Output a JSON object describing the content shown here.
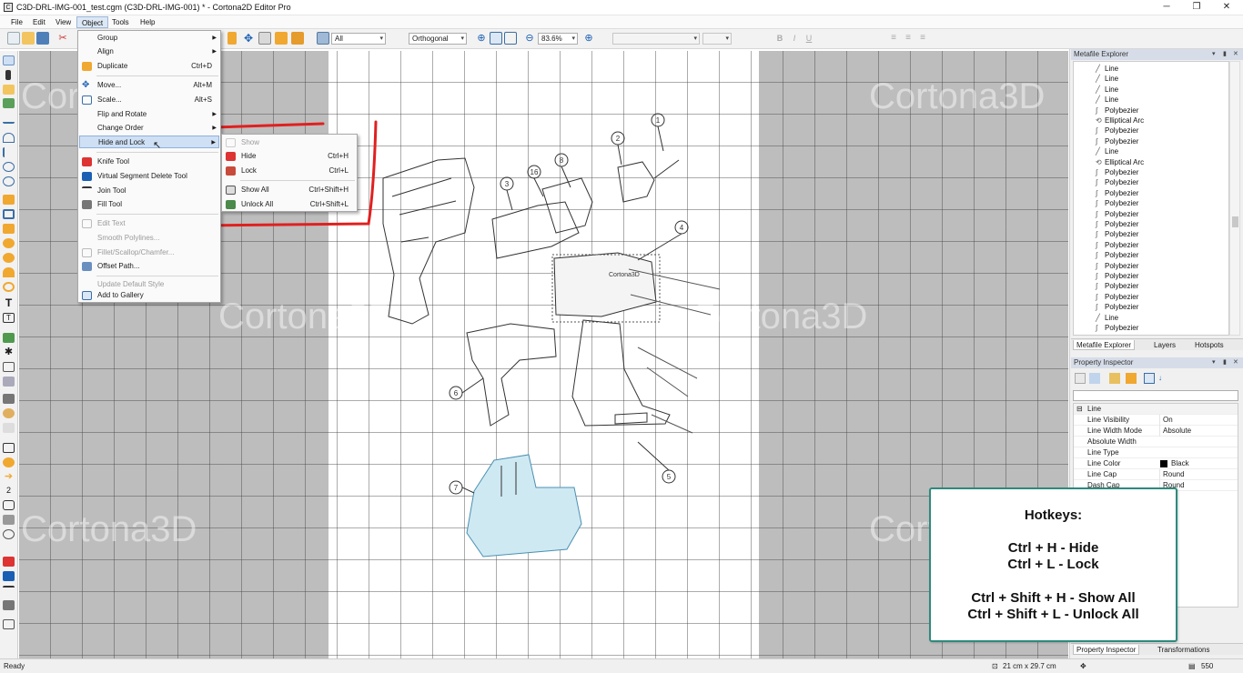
{
  "window": {
    "title": "C3D-DRL-IMG-001_test.cgm (C3D-DRL-IMG-001) * - Cortona2D Editor Pro",
    "app_icon": "C",
    "minimize_icon": "minimize-icon",
    "maximize_icon": "maximize-icon",
    "close_icon": "close-icon"
  },
  "menubar": [
    "File",
    "Edit",
    "View",
    "Object",
    "Tools",
    "Help"
  ],
  "toolbar": {
    "selection_combo": "All",
    "view_combo": "Orthogonal",
    "zoom_combo": "83.6%"
  },
  "watermark": "Cortona3D",
  "object_menu": {
    "items": [
      {
        "label": "Group",
        "shortcut": "",
        "submenu": true,
        "disabled": false
      },
      {
        "label": "Align",
        "shortcut": "",
        "submenu": true,
        "disabled": false
      },
      {
        "label": "Duplicate",
        "shortcut": "Ctrl+D",
        "submenu": false,
        "disabled": false
      },
      {
        "label": "Move...",
        "shortcut": "Alt+M",
        "submenu": false,
        "disabled": false
      },
      {
        "label": "Scale...",
        "shortcut": "Alt+S",
        "submenu": false,
        "disabled": false
      },
      {
        "label": "Flip and Rotate",
        "shortcut": "",
        "submenu": true,
        "disabled": false
      },
      {
        "label": "Change Order",
        "shortcut": "",
        "submenu": true,
        "disabled": false
      },
      {
        "label": "Hide and Lock",
        "shortcut": "",
        "submenu": true,
        "disabled": false
      },
      {
        "label": "Knife Tool",
        "shortcut": "",
        "submenu": false,
        "disabled": false
      },
      {
        "label": "Virtual Segment Delete Tool",
        "shortcut": "",
        "submenu": false,
        "disabled": false
      },
      {
        "label": "Join Tool",
        "shortcut": "",
        "submenu": false,
        "disabled": false
      },
      {
        "label": "Fill Tool",
        "shortcut": "",
        "submenu": false,
        "disabled": false
      },
      {
        "label": "Edit Text",
        "shortcut": "",
        "submenu": false,
        "disabled": true
      },
      {
        "label": "Smooth Polylines...",
        "shortcut": "",
        "submenu": false,
        "disabled": true
      },
      {
        "label": "Fillet/Scallop/Chamfer...",
        "shortcut": "",
        "submenu": false,
        "disabled": true
      },
      {
        "label": "Offset Path...",
        "shortcut": "",
        "submenu": false,
        "disabled": false
      },
      {
        "label": "Update Default Style",
        "shortcut": "",
        "submenu": false,
        "disabled": true
      },
      {
        "label": "Add to Gallery",
        "shortcut": "",
        "submenu": false,
        "disabled": false
      }
    ]
  },
  "hide_lock_submenu": {
    "items": [
      {
        "label": "Show",
        "shortcut": "",
        "disabled": true
      },
      {
        "label": "Hide",
        "shortcut": "Ctrl+H",
        "disabled": false
      },
      {
        "label": "Lock",
        "shortcut": "Ctrl+L",
        "disabled": false
      },
      {
        "label": "Show All",
        "shortcut": "Ctrl+Shift+H",
        "disabled": false
      },
      {
        "label": "Unlock All",
        "shortcut": "Ctrl+Shift+L",
        "disabled": false
      }
    ]
  },
  "drawing": {
    "callouts": [
      "1",
      "2",
      "3",
      "16",
      "8",
      "4",
      "5",
      "6",
      "7"
    ]
  },
  "metafile_explorer": {
    "title": "Metafile Explorer",
    "items": [
      "Line",
      "Line",
      "Line",
      "Line",
      "Polybezier",
      "Elliptical Arc",
      "Polybezier",
      "Polybezier",
      "Line",
      "Elliptical Arc",
      "Polybezier",
      "Polybezier",
      "Polybezier",
      "Polybezier",
      "Polybezier",
      "Polybezier",
      "Polybezier",
      "Polybezier",
      "Polybezier",
      "Polybezier",
      "Polybezier",
      "Polybezier",
      "Polybezier",
      "Polybezier",
      "Line",
      "Polybezier"
    ],
    "tabs": [
      "Metafile Explorer",
      "Layers",
      "Hotspots"
    ]
  },
  "property_inspector": {
    "title": "Property Inspector",
    "group": "Line",
    "rows": [
      {
        "key": "Line Visibility",
        "value": "On"
      },
      {
        "key": "Line Width Mode",
        "value": "Absolute"
      },
      {
        "key": "Absolute Width",
        "value": ""
      },
      {
        "key": "Line Type",
        "value": ""
      },
      {
        "key": "Line Color",
        "value": "Black"
      },
      {
        "key": "Line Cap",
        "value": "Round"
      },
      {
        "key": "Dash Cap",
        "value": "Round"
      }
    ],
    "tabs": [
      "Property Inspector",
      "Transformations"
    ]
  },
  "hotkeys_box": {
    "title": "Hotkeys:",
    "lines": [
      "Ctrl + H - Hide",
      "Ctrl + L - Lock",
      "Ctrl + Shift + H - Show All",
      "Ctrl + Shift + L - Unlock All"
    ]
  },
  "statusbar": {
    "status": "Ready",
    "page_size": "21 cm x 29.7 cm",
    "coord": "550"
  },
  "colors": {
    "accent": "#2d8a7c",
    "highlight_box": "#e02020",
    "menu_highlight": "#cfe0f5",
    "battery_fill": "#cfe9f3"
  }
}
